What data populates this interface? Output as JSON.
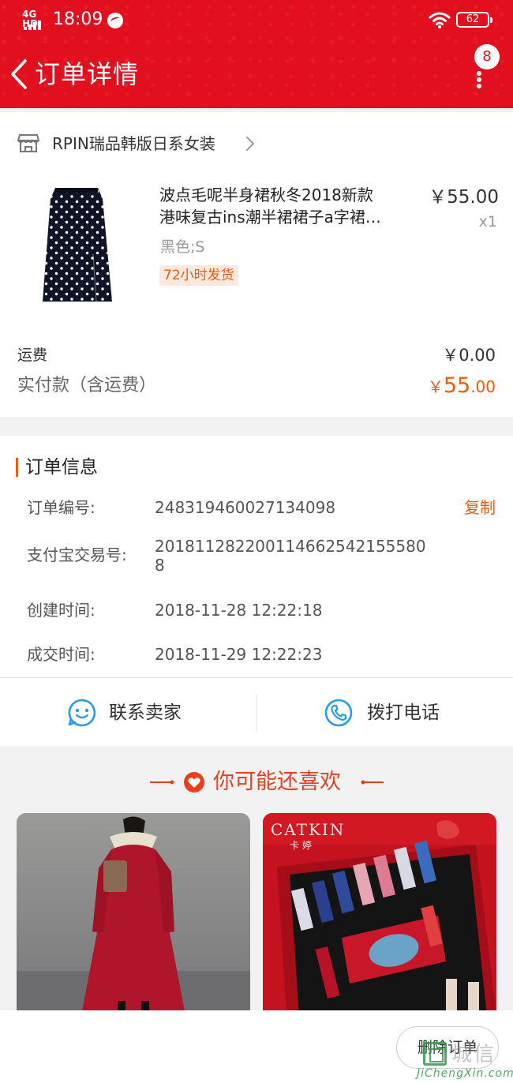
{
  "status_bar": {
    "network": "4G HD",
    "time": "18:09",
    "battery": "62"
  },
  "nav": {
    "title": "订单详情",
    "badge_count": "8"
  },
  "shop": {
    "name": "RPIN瑞品韩版日系女装"
  },
  "product": {
    "title_line1": "波点毛呢半身裙秋冬2018新款",
    "title_line2": "港味复古ins潮半裙裙子a字裙…",
    "variant": "黑色;S",
    "ship_tag": "72小时发货",
    "price": "￥55.00",
    "quantity": "x1"
  },
  "summary": {
    "shipping_label": "运费",
    "shipping_value": "￥0.00",
    "paid_label": "实付款（含运费）",
    "paid_currency": "￥",
    "paid_integer": "55",
    "paid_decimal": ".00"
  },
  "order_info": {
    "title": "订单信息",
    "copy_label": "复制",
    "rows": [
      {
        "label": "订单编号:",
        "value": "248319460027134098"
      },
      {
        "label": "支付宝交易号:",
        "value": "2018112822001146625421555808"
      },
      {
        "label": "创建时间:",
        "value": "2018-11-28 12:22:18"
      },
      {
        "label": "成交时间:",
        "value": "2018-11-29 12:22:23"
      }
    ]
  },
  "contact": {
    "seller_label": "联系卖家",
    "phone_label": "拨打电话"
  },
  "recommend": {
    "title": "你可能还喜欢",
    "brand_text": "CATKIN",
    "brand_cn": "卡 婷"
  },
  "bottom": {
    "delete_label": "删除订单"
  },
  "watermark": {
    "cn": "城信",
    "url": "JiChengXin.com"
  },
  "colors": {
    "header_red": "#e2101f",
    "accent_orange": "#f05a10",
    "link_blue": "#2a9be8"
  }
}
